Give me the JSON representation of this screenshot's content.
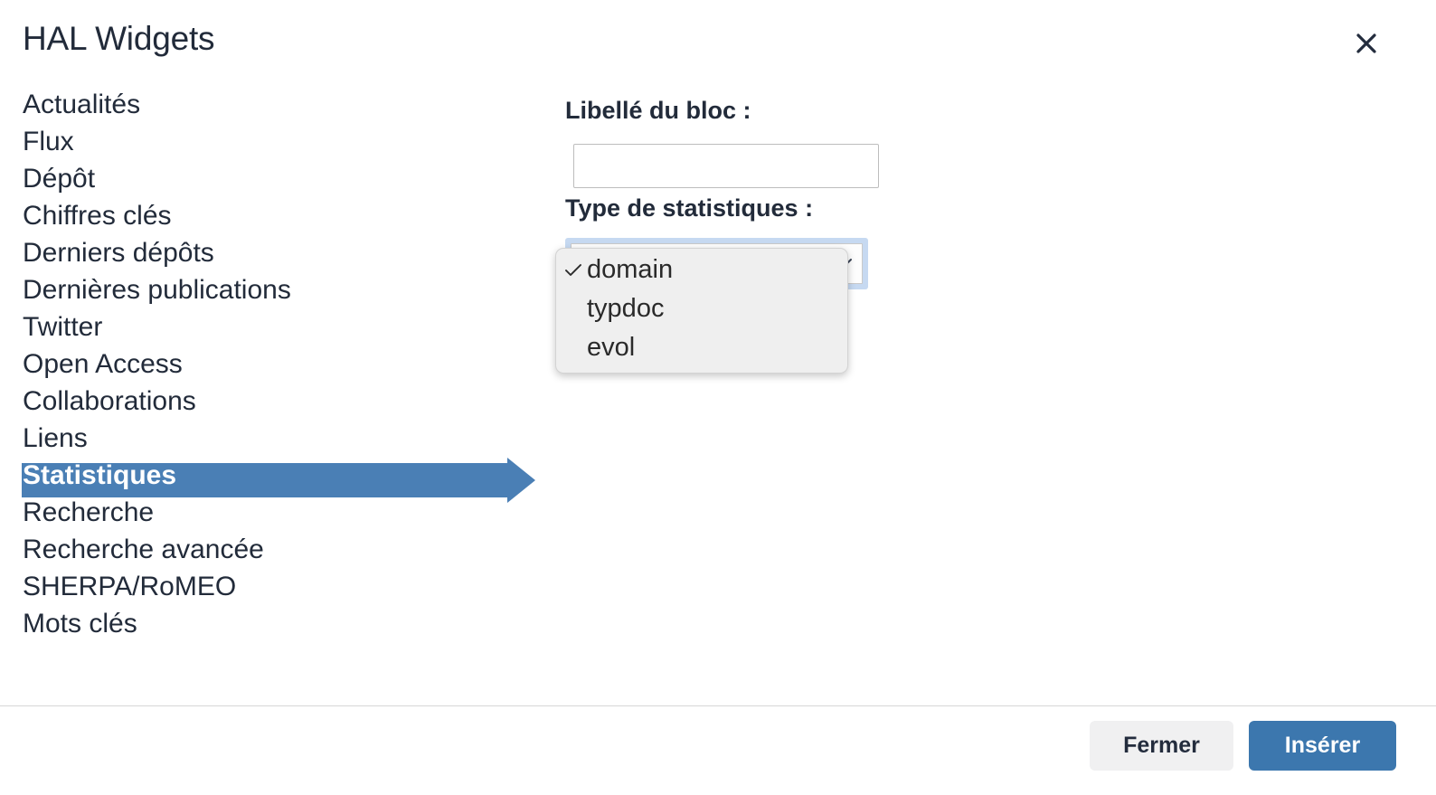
{
  "header": {
    "title": "HAL Widgets",
    "close_icon": "close-icon"
  },
  "widget_list": {
    "items": [
      {
        "label": "Actualités",
        "selected": false
      },
      {
        "label": "Flux",
        "selected": false
      },
      {
        "label": "Dépôt",
        "selected": false
      },
      {
        "label": "Chiffres clés",
        "selected": false
      },
      {
        "label": "Derniers dépôts",
        "selected": false
      },
      {
        "label": "Dernières publications",
        "selected": false
      },
      {
        "label": "Twitter",
        "selected": false
      },
      {
        "label": "Open Access",
        "selected": false
      },
      {
        "label": "Collaborations",
        "selected": false
      },
      {
        "label": "Liens",
        "selected": false
      },
      {
        "label": "Statistiques",
        "selected": true
      },
      {
        "label": "Recherche",
        "selected": false
      },
      {
        "label": "Recherche avancée",
        "selected": false
      },
      {
        "label": "SHERPA/RoMEO",
        "selected": false
      },
      {
        "label": "Mots clés",
        "selected": false
      }
    ],
    "selected_label": "Statistiques",
    "highlight_color": "#4a7fb5"
  },
  "form": {
    "block_label_field": {
      "label": "Libellé du bloc :",
      "value": "",
      "placeholder": ""
    },
    "stat_type_field": {
      "label": "Type de statistiques :",
      "selected_value": "domain",
      "chevron_icon": "chevron-down-icon",
      "options": [
        "domain",
        "typdoc",
        "evol"
      ]
    }
  },
  "dropdown": {
    "open": true,
    "checked_option": "domain",
    "check_icon": "check-icon",
    "options": [
      {
        "label": "domain",
        "checked": true
      },
      {
        "label": "typdoc",
        "checked": false
      },
      {
        "label": "evol",
        "checked": false
      }
    ]
  },
  "footer": {
    "close_label": "Fermer",
    "insert_label": "Insérer",
    "insert_color": "#3c77ae"
  }
}
